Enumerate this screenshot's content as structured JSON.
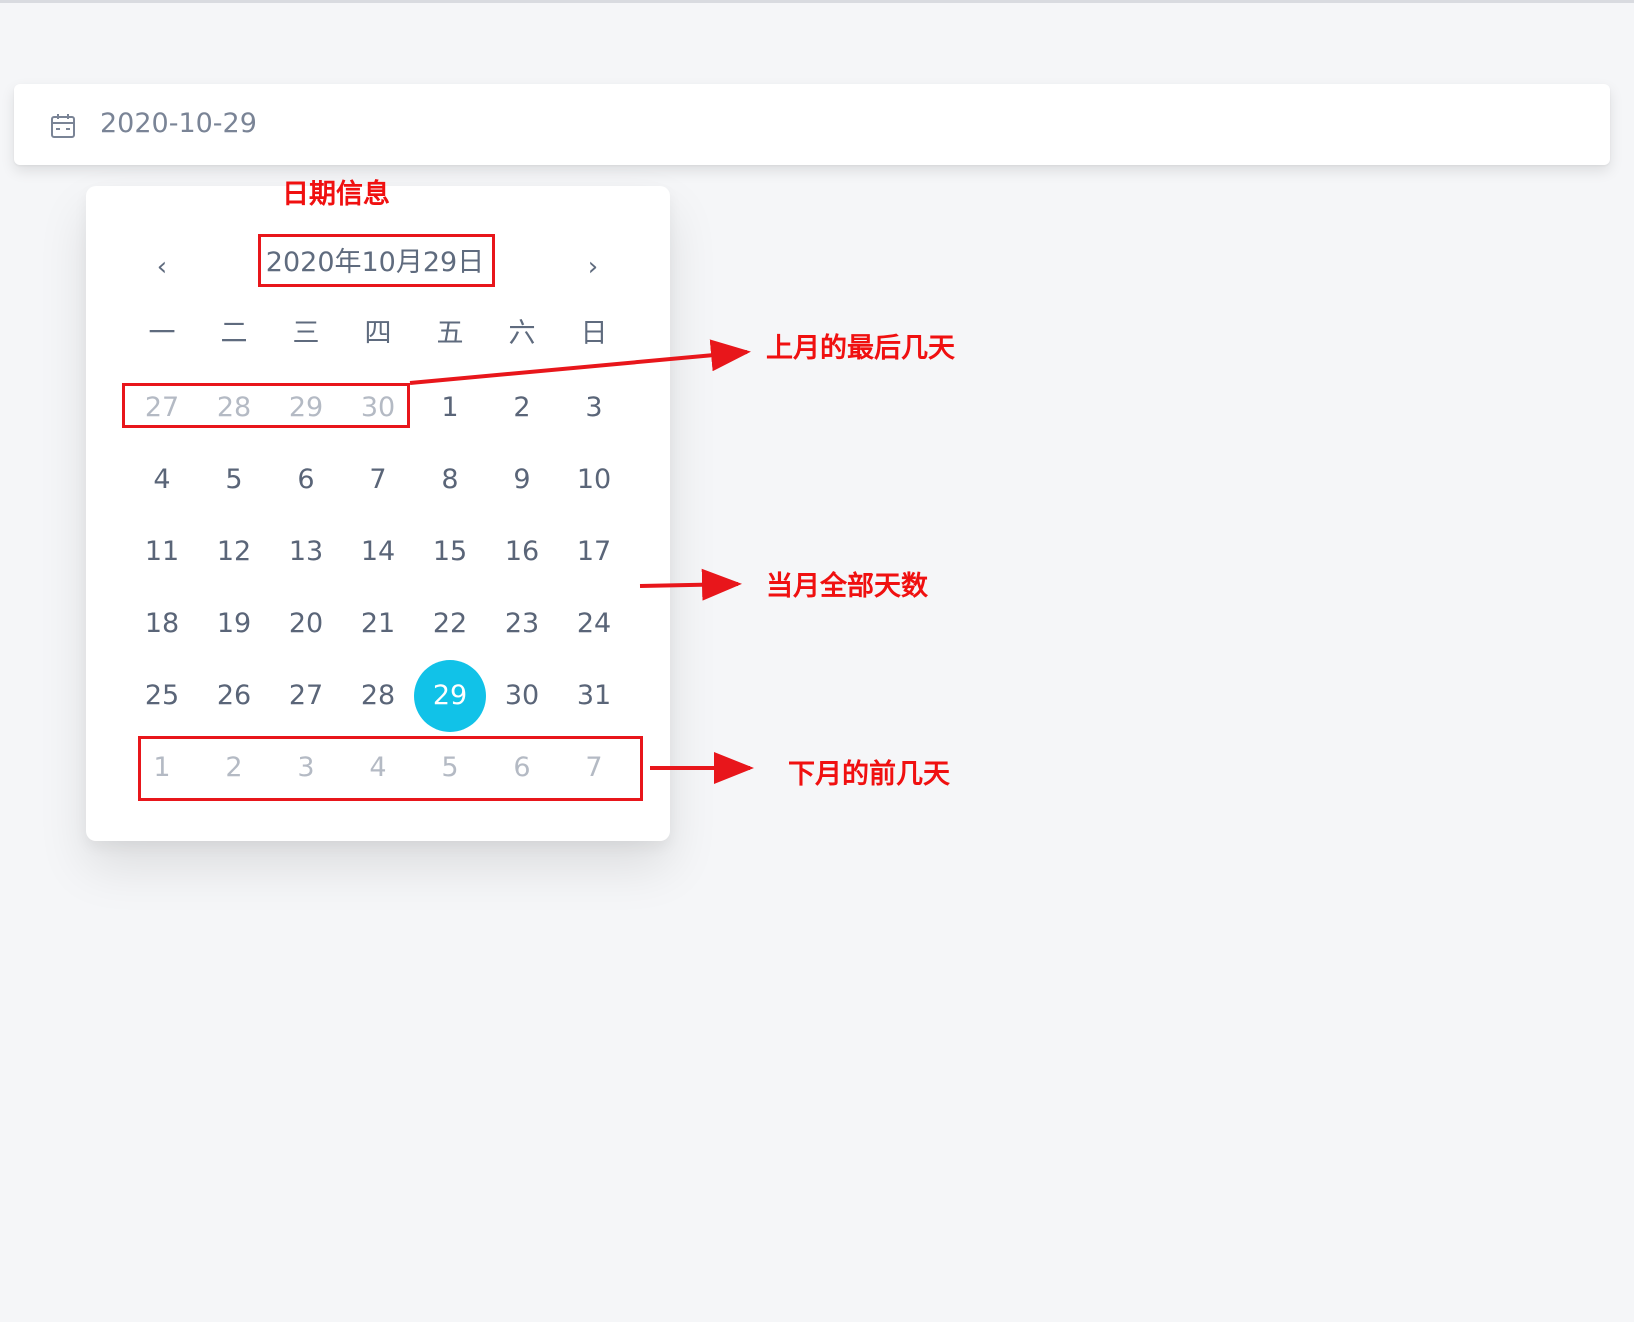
{
  "input": {
    "value": "2020-10-29",
    "icon": "calendar-icon"
  },
  "calendar": {
    "prev_label": "‹",
    "next_label": "›",
    "title": "2020年10月29日",
    "weekdays": [
      "一",
      "二",
      "三",
      "四",
      "五",
      "六",
      "日"
    ],
    "days": [
      [
        "27",
        "28",
        "29",
        "30",
        "1",
        "2",
        "3"
      ],
      [
        "4",
        "5",
        "6",
        "7",
        "8",
        "9",
        "10"
      ],
      [
        "11",
        "12",
        "13",
        "14",
        "15",
        "16",
        "17"
      ],
      [
        "18",
        "19",
        "20",
        "21",
        "22",
        "23",
        "24"
      ],
      [
        "25",
        "26",
        "27",
        "28",
        "29",
        "30",
        "31"
      ],
      [
        "1",
        "2",
        "3",
        "4",
        "5",
        "6",
        "7"
      ]
    ],
    "selected_day": "29",
    "accent_color": "#11c2e8"
  },
  "annotations": {
    "date_info": "日期信息",
    "prev_month_days": "上月的最后几天",
    "current_month_days": "当月全部天数",
    "next_month_days": "下月的前几天",
    "color": "#f01010"
  }
}
